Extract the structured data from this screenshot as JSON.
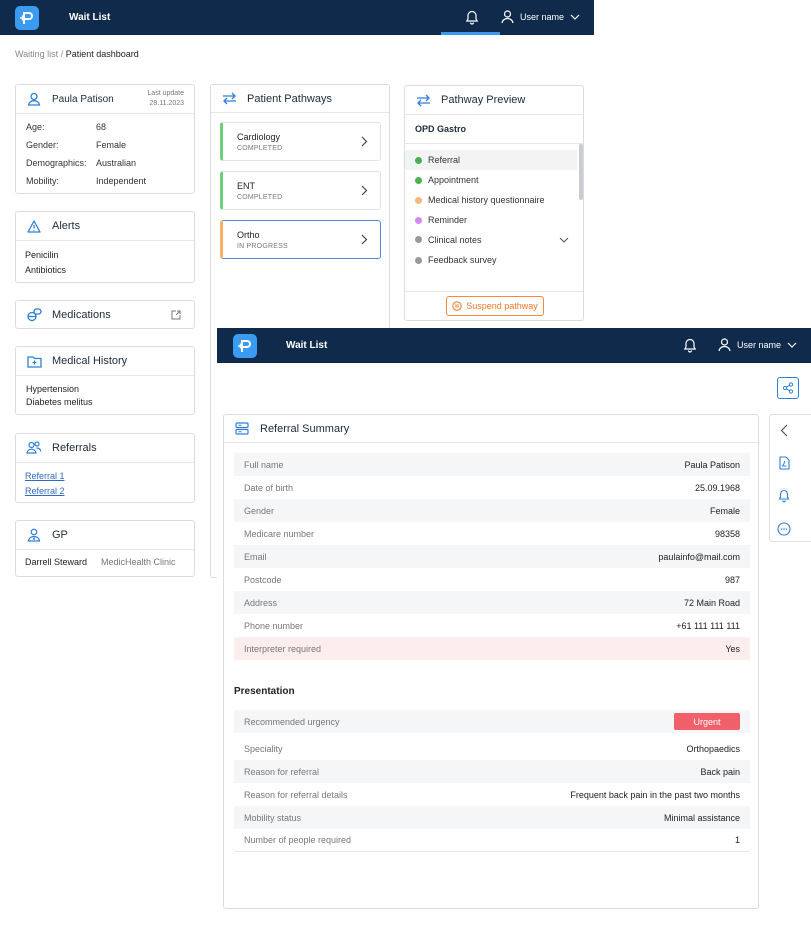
{
  "app": {
    "title": "Wait List",
    "user_name": "User name"
  },
  "breadcrumb": {
    "parent": "Waiting list",
    "separator": " / ",
    "current": "Patient dashboard"
  },
  "patient": {
    "name": "Paula Patison",
    "last_update_label": "Last update",
    "last_update_date": "28.11.2023",
    "fields": [
      {
        "label": "Age:",
        "value": "68"
      },
      {
        "label": "Gender:",
        "value": "Female"
      },
      {
        "label": "Demographics:",
        "value": "Australian"
      },
      {
        "label": "Mobility:",
        "value": "Independent"
      }
    ]
  },
  "alerts": {
    "title": "Alerts",
    "items": [
      "Penicilin",
      "Antibiotics"
    ]
  },
  "medications": {
    "title": "Medications"
  },
  "medical_history": {
    "title": "Medical History",
    "items": [
      "Hypertension",
      "Diabetes melitus"
    ]
  },
  "referrals": {
    "title": "Referrals",
    "items": [
      "Referral 1",
      "Referral 2"
    ]
  },
  "gp": {
    "title": "GP",
    "name": "Darrell Steward",
    "clinic": "MedicHealth Clinic"
  },
  "pathways": {
    "title": "Patient Pathways",
    "items": [
      {
        "name": "Cardiology",
        "status": "COMPLETED",
        "color": "#6fd07a"
      },
      {
        "name": "ENT",
        "status": "COMPLETED",
        "color": "#6fd07a"
      },
      {
        "name": "Ortho",
        "status": "IN PROGRESS",
        "color": "#f7b267"
      }
    ]
  },
  "preview": {
    "title": "Pathway Preview",
    "subtitle": "OPD Gastro",
    "steps": [
      {
        "label": "Referral",
        "color": "#4caf50"
      },
      {
        "label": "Appointment",
        "color": "#4caf50"
      },
      {
        "label": "Medical history questionnaire",
        "color": "#f6b97c"
      },
      {
        "label": "Reminder",
        "color": "#d48af0"
      },
      {
        "label": "Clinical notes",
        "color": "#999999"
      },
      {
        "label": "Feedback survey",
        "color": "#999999"
      }
    ],
    "suspend_label": "Suspend pathway"
  },
  "referral_summary": {
    "title": "Referral Summary",
    "rows": [
      {
        "label": "Full name",
        "value": "Paula Patison"
      },
      {
        "label": "Date of birth",
        "value": "25.09.1968"
      },
      {
        "label": "Gender",
        "value": "Female"
      },
      {
        "label": "Medicare number",
        "value": "98358"
      },
      {
        "label": "Email",
        "value": "paulainfo@mail.com"
      },
      {
        "label": "Postcode",
        "value": "987"
      },
      {
        "label": "Address",
        "value": "72 Main Road"
      },
      {
        "label": "Phone number",
        "value": "+61 111 111 111"
      },
      {
        "label": "Interpreter required",
        "value": "Yes"
      }
    ],
    "presentation_title": "Presentation",
    "presentation": [
      {
        "label": "Recommended urgency",
        "value": "Urgent"
      },
      {
        "label": "Speciality",
        "value": "Orthopaedics"
      },
      {
        "label": "Reason for referral",
        "value": "Back pain"
      },
      {
        "label": "Reason for referral details",
        "value": "Frequent back pain in the past two months"
      },
      {
        "label": "Mobility status",
        "value": "Minimal assistance"
      },
      {
        "label": "Number of people required",
        "value": "1"
      }
    ]
  },
  "colors": {
    "navy": "#0f2a4a",
    "accent": "#3b9bf0",
    "urgent": "#f0606a",
    "warning": "#f58a3c"
  }
}
